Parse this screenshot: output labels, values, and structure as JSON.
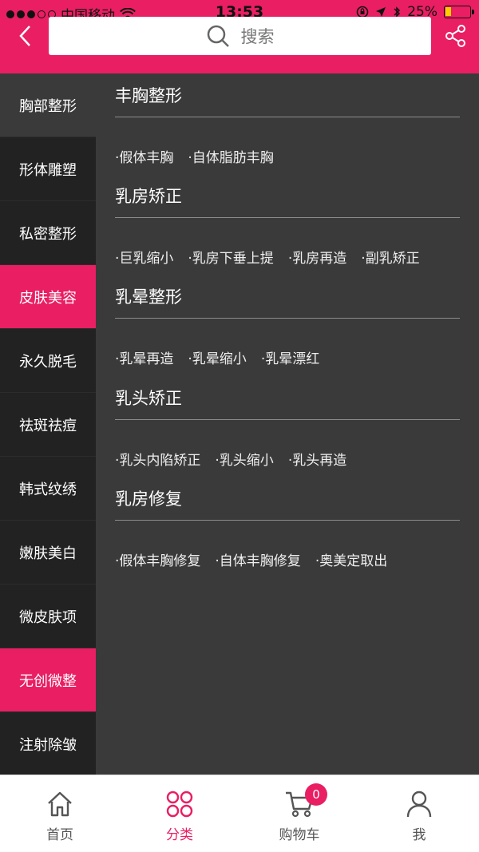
{
  "status_bar": {
    "carrier": "中国移动",
    "time": "13:53",
    "battery_percent": "25%",
    "battery_level": 0.25
  },
  "header": {
    "search_placeholder": "搜索",
    "accent_color": "#e91e63"
  },
  "sidebar": {
    "items": [
      {
        "label": "胸部整形",
        "state": "selected"
      },
      {
        "label": "形体雕塑",
        "state": "normal"
      },
      {
        "label": "私密整形",
        "state": "normal"
      },
      {
        "label": "皮肤美容",
        "state": "highlight"
      },
      {
        "label": "永久脱毛",
        "state": "normal"
      },
      {
        "label": "祛斑祛痘",
        "state": "normal"
      },
      {
        "label": "韩式纹绣",
        "state": "normal"
      },
      {
        "label": "嫩肤美白",
        "state": "normal"
      },
      {
        "label": "微皮肤项",
        "state": "normal"
      },
      {
        "label": "无创微整",
        "state": "highlight"
      },
      {
        "label": "注射除皱",
        "state": "normal"
      }
    ]
  },
  "sections": [
    {
      "title": "丰胸整形",
      "items": [
        "·假体丰胸",
        "·自体脂肪丰胸"
      ]
    },
    {
      "title": "乳房矫正",
      "items": [
        "·巨乳缩小",
        "·乳房下垂上提",
        "·乳房再造",
        "·副乳矫正"
      ]
    },
    {
      "title": "乳晕整形",
      "items": [
        "·乳晕再造",
        "·乳晕缩小",
        "·乳晕漂红"
      ]
    },
    {
      "title": "乳头矫正",
      "items": [
        "·乳头内陷矫正",
        "·乳头缩小",
        "·乳头再造"
      ]
    },
    {
      "title": "乳房修复",
      "items": [
        "·假体丰胸修复",
        "·自体丰胸修复",
        "·奥美定取出"
      ]
    }
  ],
  "tabbar": {
    "tabs": [
      {
        "label": "首页",
        "icon": "home-icon"
      },
      {
        "label": "分类",
        "icon": "category-icon"
      },
      {
        "label": "购物车",
        "icon": "cart-icon"
      },
      {
        "label": "我",
        "icon": "user-icon"
      }
    ],
    "active": "分类",
    "cart_count": "0"
  }
}
